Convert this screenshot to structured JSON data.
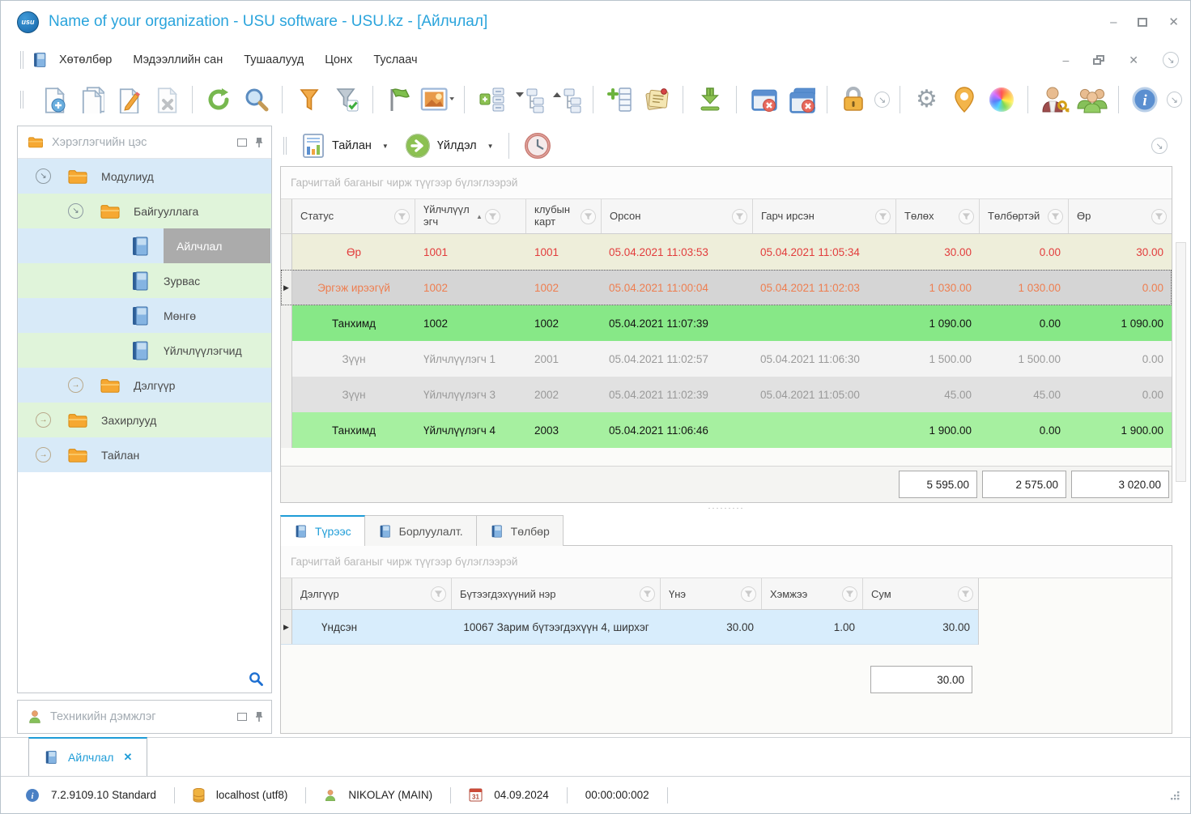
{
  "window": {
    "title": "Name of your organization - USU software - USU.kz - [Айлчлал]",
    "logo_text": "usu",
    "controls": {
      "minimize": "–",
      "close": "✕"
    }
  },
  "menu": {
    "items": [
      "Хөтөлбөр",
      "Мэдээллийн сан",
      "Тушаалууд",
      "Цонх",
      "Туслаач"
    ]
  },
  "toolbar": {
    "icons": [
      "new-document",
      "copy-document",
      "edit-document",
      "delete-document",
      "refresh",
      "search",
      "filter",
      "filter-apply",
      "flag",
      "image-view",
      "expand-list",
      "collapse-tree",
      "expand-tree",
      "add-row",
      "notes",
      "export-download",
      "close-window",
      "close-all-windows",
      "lock",
      "toolbar-overflow",
      "settings-gear",
      "location-pin",
      "color-wheel",
      "user-permissions",
      "users-group",
      "info"
    ]
  },
  "sidebar": {
    "title": "Хэрэглэгчийн цэс",
    "tree": [
      {
        "label": "Модулиуд"
      },
      {
        "label": "Байгууллага"
      },
      {
        "label": "Айлчлал"
      },
      {
        "label": "Зурвас"
      },
      {
        "label": "Мөнгө"
      },
      {
        "label": "Үйлчлүүлэгчид"
      },
      {
        "label": "Дэлгүүр"
      },
      {
        "label": "Захирлууд"
      },
      {
        "label": "Тайлан"
      }
    ],
    "support": "Техникийн дэмжлэг"
  },
  "actionbar": {
    "report": "Тайлан",
    "action": "Үйлдэл",
    "icons": [
      "report",
      "run-action",
      "clock"
    ]
  },
  "grid": {
    "group_hint": "Гарчигтай баганыг чирж түүгээр бүлэглээрэй",
    "columns": {
      "status": "Статус",
      "client": "Үйлчлүүлэгч",
      "card": "клубын карт",
      "entered": "Орсон",
      "exited": "Гарч ирсэн",
      "pay": "Төлөх",
      "paid": "Төлбөртэй",
      "debt": "Өр"
    },
    "rows": [
      {
        "status": "Өр",
        "client": "1001",
        "card": "1001",
        "entered": "05.04.2021 11:03:53",
        "exited": "05.04.2021 11:05:34",
        "pay": "30.00",
        "paid": "0.00",
        "debt": "30.00"
      },
      {
        "status": "Эргэж ирээгүй",
        "client": "1002",
        "card": "1002",
        "entered": "05.04.2021 11:00:04",
        "exited": "05.04.2021 11:02:03",
        "pay": "1 030.00",
        "paid": "1 030.00",
        "debt": "0.00"
      },
      {
        "status": "Танхимд",
        "client": "1002",
        "card": "1002",
        "entered": "05.04.2021 11:07:39",
        "exited": "",
        "pay": "1 090.00",
        "paid": "0.00",
        "debt": "1 090.00"
      },
      {
        "status": "Зүүн",
        "client": "Үйлчлүүлэгч 1",
        "card": "2001",
        "entered": "05.04.2021 11:02:57",
        "exited": "05.04.2021 11:06:30",
        "pay": "1 500.00",
        "paid": "1 500.00",
        "debt": "0.00"
      },
      {
        "status": "Зүүн",
        "client": "Үйлчлүүлэгч 3",
        "card": "2002",
        "entered": "05.04.2021 11:02:39",
        "exited": "05.04.2021 11:05:00",
        "pay": "45.00",
        "paid": "45.00",
        "debt": "0.00"
      },
      {
        "status": "Танхимд",
        "client": "Үйлчлүүлэгч 4",
        "card": "2003",
        "entered": "05.04.2021 11:06:46",
        "exited": "",
        "pay": "1 900.00",
        "paid": "0.00",
        "debt": "1 900.00"
      }
    ],
    "totals": {
      "pay": "5 595.00",
      "paid": "2 575.00",
      "debt": "3 020.00"
    }
  },
  "detail": {
    "tabs": [
      {
        "label": "Түрээс"
      },
      {
        "label": "Борлуулалт."
      },
      {
        "label": "Төлбөр"
      }
    ],
    "group_hint": "Гарчигтай баганыг чирж түүгээр бүлэглээрэй",
    "columns": {
      "shop": "Дэлгүүр",
      "product": "Бүтээгдэхүүний нэр",
      "price": "Үнэ",
      "qty": "Хэмжээ",
      "sum": "Сум"
    },
    "rows": [
      {
        "shop": "Үндсэн",
        "product": "10067 Зарим бүтээгдэхүүн 4, ширхэг",
        "price": "30.00",
        "qty": "1.00",
        "sum": "30.00"
      }
    ],
    "total": "30.00"
  },
  "doc_tabs": {
    "active": "Айлчлал",
    "close_glyph": "✕"
  },
  "statusbar": {
    "version": "7.2.9109.10 Standard",
    "database": "localhost (utf8)",
    "user": "NIKOLAY (MAIN)",
    "date": "04.09.2024",
    "timer": "00:00:00:002",
    "icons": [
      "info",
      "database",
      "user",
      "calendar"
    ]
  },
  "colors": {
    "accent_blue": "#2aa4dc",
    "row_debt_text": "#e23c3c",
    "row_debt_bg": "#eeeeda",
    "row_not_returned_text": "#ee7e50",
    "row_not_returned_bg": "#d5d5d5",
    "row_in_hall_bg": "#87e887",
    "row_left_text": "#9a9a9a",
    "tree_row_blue": "#d8eaf8",
    "tree_row_green": "#e0f4da",
    "detail_row_bg": "#d8edfc"
  }
}
